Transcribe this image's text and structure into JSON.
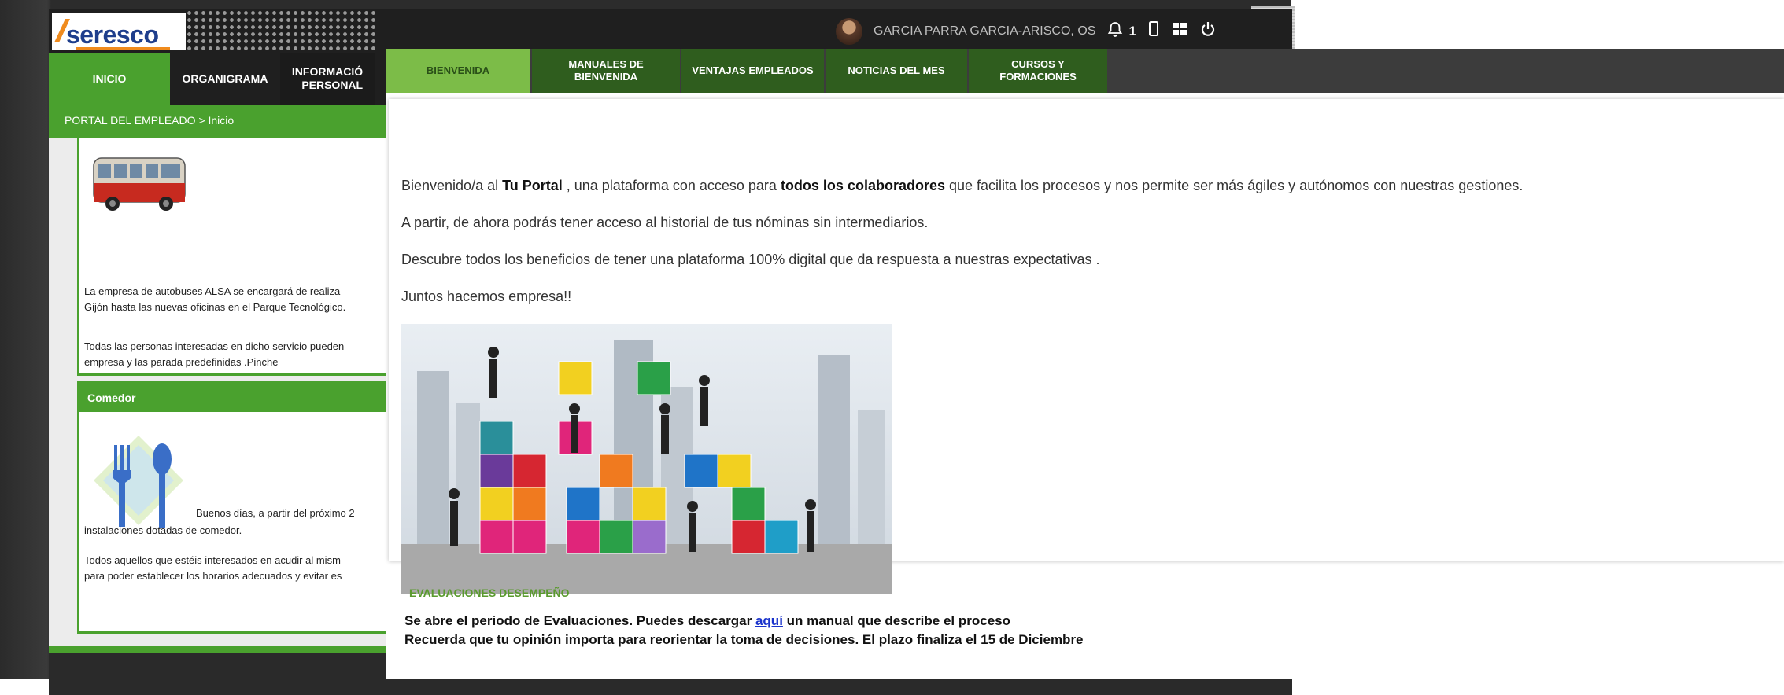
{
  "back_window": {
    "logo": "seresco",
    "user_name": "GARCIA PARRA GARCIA-ARISCO, OS",
    "bell_count": "1",
    "nav": {
      "inicio": "INICIO",
      "organigrama": "ORGANIGRAMA",
      "informacion_l1": "INFORMACIÓ",
      "informacion_l2": "PERSONAL"
    },
    "breadcrumb": "PORTAL DEL EMPLEADO > Inicio",
    "card1": {
      "line1": "La empresa de autobuses ALSA  se encargará de realiza",
      "line2": "Gijón hasta las nuevas oficinas en el Parque Tecnológico.",
      "line3": "Todas las personas interesadas en dicho servicio pueden",
      "line4": "empresa y las parada predefinidas .Pinche"
    },
    "card2": {
      "title": "Comedor",
      "line1": "Buenos días, a partir del próximo 2",
      "line2": "instalaciones dotadas de comedor.",
      "line3": "Todos aquellos que estéis interesados en acudir al mism",
      "line4": "para poder establecer los horarios adecuados y evitar es"
    }
  },
  "front_window": {
    "tabs": [
      {
        "l1": "BIENVENIDA",
        "l2": ""
      },
      {
        "l1": "MANUALES DE",
        "l2": "BIENVENIDA"
      },
      {
        "l1": "VENTAJAS EMPLEADOS",
        "l2": ""
      },
      {
        "l1": "NOTICIAS DEL MES",
        "l2": ""
      },
      {
        "l1": "CURSOS Y",
        "l2": "FORMACIONES"
      }
    ],
    "intro": {
      "p1_a": "Bienvenido/a al ",
      "p1_b": "Tu Portal",
      "p1_c": " , una plataforma con acceso para ",
      "p1_d": "todos los colaboradores",
      "p1_e": " que facilita los procesos y nos permite ser más ágiles y autónomos con nuestras gestiones.",
      "p2": "A partir, de ahora podrás tener acceso al historial de tus nóminas sin intermediarios.",
      "p3": "Descubre todos los beneficios de tener una plataforma 100% digital que da respuesta a nuestras expectativas .",
      "p4": "Juntos hacemos empresa!!"
    },
    "evaluaciones": {
      "title": "EVALUACIONES DESEMPEÑO",
      "line1_a": "Se abre el periodo de Evaluaciones. Puedes descargar ",
      "line1_link": "aquí",
      "line1_b": " un manual que describe el proceso",
      "line2": "Recuerda que tu opinión importa para reorientar la toma de decisiones. El plazo finaliza el 15 de Diciembre"
    }
  },
  "colors": {
    "brand_green": "#4aa12e",
    "tab_dark_green": "#2f5d1e",
    "tab_active": "#7cbc48",
    "header_dark": "#1f1f1f",
    "logo_blue": "#1e3e8c",
    "logo_orange": "#f08b1d"
  }
}
